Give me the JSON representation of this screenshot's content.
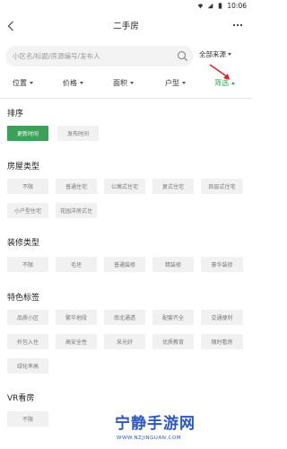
{
  "status_bar": {
    "time": "10:06"
  },
  "header": {
    "title": "二手房"
  },
  "search": {
    "placeholder": "小区名/标题/房源编号/发布人",
    "source_label": "全部来源"
  },
  "filter_tabs": [
    {
      "label": "位置"
    },
    {
      "label": "价格"
    },
    {
      "label": "面积"
    },
    {
      "label": "户型"
    },
    {
      "label": "筛选"
    }
  ],
  "sections": {
    "sort": {
      "title": "排序",
      "options": [
        "更新时间",
        "发布时间"
      ],
      "selected": "更新时间"
    },
    "house_type": {
      "title": "房屋类型",
      "options": [
        "不限",
        "普通住宅",
        "公寓式住宅",
        "复式住宅",
        "跃层式住宅",
        "小户型住宅",
        "花园洋房式住"
      ]
    },
    "decoration": {
      "title": "装修类型",
      "options": [
        "不限",
        "毛坯",
        "普通装修",
        "精装修",
        "豪华装修"
      ]
    },
    "features": {
      "title": "特色标签",
      "options": [
        "品质小区",
        "繁华地段",
        "南北通透",
        "配套齐全",
        "交通便利",
        "拎包入住",
        "高安全性",
        "采光好",
        "优质教育",
        "随时看房",
        "绿化率高"
      ]
    },
    "vr": {
      "title": "VR看房",
      "options": [
        "不限"
      ]
    }
  },
  "colors": {
    "accent": "#3aa157",
    "chip_bg": "#f1f1f1",
    "annotation": "#e02020"
  },
  "watermark": {
    "brand": "宁静手游网",
    "url": "WWW.NZJINGUAN.COM"
  }
}
